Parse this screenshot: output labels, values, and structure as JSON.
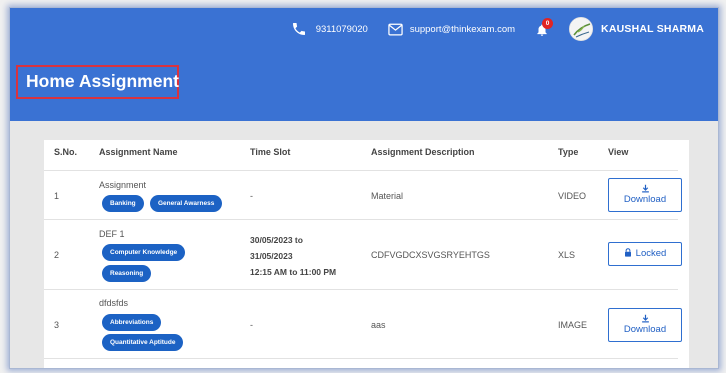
{
  "header": {
    "phone": "9311079020",
    "email": "support@thinkexam.com",
    "notification_count": "0",
    "user_name": "KAUSHAL SHARMA",
    "page_title": "Home Assignment",
    "background_color": "#3a72d3"
  },
  "icons": {
    "phone": "phone-icon",
    "email": "mail-icon",
    "notifications": "bell-icon",
    "download": "download-icon",
    "lock": "lock-icon"
  },
  "table": {
    "columns": [
      "S.No.",
      "Assignment Name",
      "Time Slot",
      "Assignment Description",
      "Type",
      "View"
    ],
    "rows": [
      {
        "sno": "1",
        "name": "Assignment",
        "tags": [
          "Banking",
          "General Awarness"
        ],
        "time_slot": "-",
        "description": "Material",
        "type": "VIDEO",
        "action": "Download"
      },
      {
        "sno": "2",
        "name": "DEF 1",
        "tags": [
          "Computer Knowledge",
          "Reasoning"
        ],
        "time_slot_lines": [
          "30/05/2023 to",
          "31/05/2023",
          "12:15 AM to 11:00 PM"
        ],
        "description": "CDFVGDCXSVGSRYEHTGS",
        "type": "XLS",
        "action": "Locked"
      },
      {
        "sno": "3",
        "name": "dfdsfds",
        "tags": [
          "Abbreviations",
          "Quantitative Aptitude"
        ],
        "time_slot": "-",
        "description": "aas",
        "type": "IMAGE",
        "action": "Download"
      }
    ]
  }
}
